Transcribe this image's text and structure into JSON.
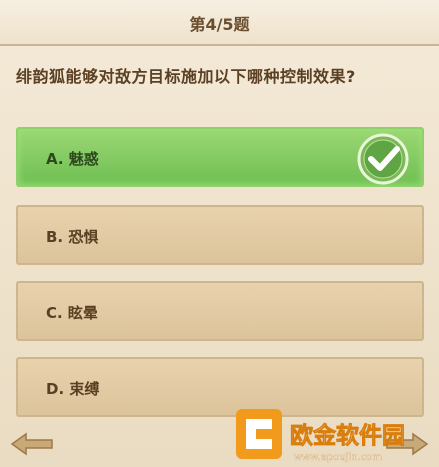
{
  "header": {
    "title": "第4/5题"
  },
  "question": {
    "text": "绯韵狐能够对敌方目标施加以下哪种控制效果?"
  },
  "options": [
    {
      "label": "A. 魅惑",
      "correct": true
    },
    {
      "label": "B. 恐惧",
      "correct": false
    },
    {
      "label": "C. 眩晕",
      "correct": false
    },
    {
      "label": "D. 束缚",
      "correct": false
    }
  ],
  "watermark": {
    "brand": "欧金软件园",
    "url": "www.apoujin.com"
  },
  "colors": {
    "correct": "#7cc85a",
    "option": "#e2c9a2",
    "text": "#5b3f22"
  }
}
